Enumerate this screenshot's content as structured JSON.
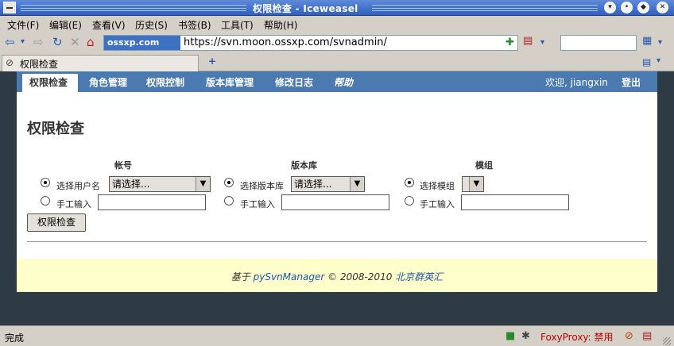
{
  "window": {
    "title": "权限检查 - Iceweasel"
  },
  "menubar": {
    "items": [
      "文件(F)",
      "编辑(E)",
      "查看(V)",
      "历史(S)",
      "书签(B)",
      "工具(T)",
      "帮助(H)"
    ]
  },
  "navbar": {
    "site_badge": "ossxp.com",
    "url": "https://svn.moon.ossxp.com/svnadmin/"
  },
  "tab": {
    "title": "权限检查"
  },
  "page": {
    "nav": [
      "权限检查",
      "角色管理",
      "权限控制",
      "版本库管理",
      "修改日志",
      "帮助"
    ],
    "welcome": "欢迎, jiangxin",
    "logout": "登出",
    "title": "权限检查",
    "columns": {
      "account": {
        "header": "帐号",
        "select_label": "选择用户名",
        "select_value": "请选择...",
        "manual_label": "手工输入"
      },
      "repo": {
        "header": "版本库",
        "select_label": "选择版本库",
        "select_value": "请选择...",
        "manual_label": "手工输入"
      },
      "module": {
        "header": "模组",
        "select_label": "选择模组",
        "select_value": "",
        "manual_label": "手工输入"
      }
    },
    "check_button": "权限检查",
    "footer": {
      "prefix": "基于",
      "link1": "pySvnManager",
      "middle": "© 2008-2010",
      "link2": "北京群英汇"
    }
  },
  "status": {
    "text": "完成",
    "foxy": "FoxyProxy: 禁用"
  }
}
